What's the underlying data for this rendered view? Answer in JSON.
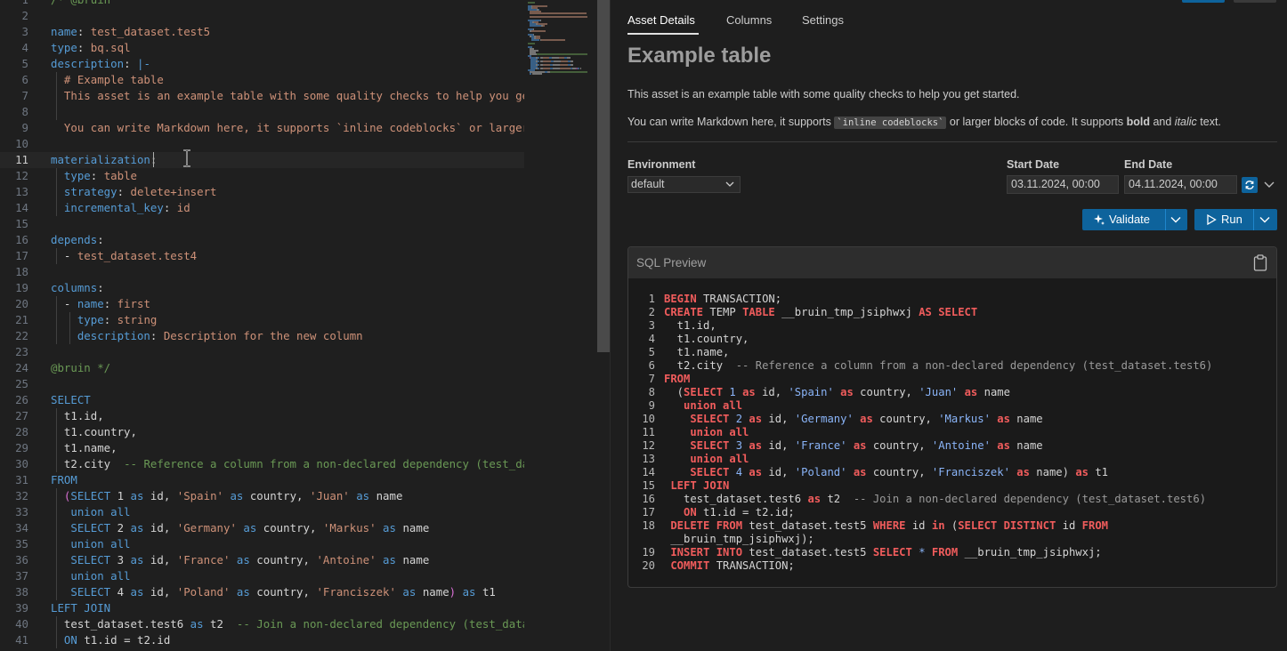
{
  "editor": {
    "line_numbers": [
      "1",
      "2",
      "3",
      "4",
      "5",
      "6",
      "7",
      "8",
      "9",
      "10",
      "11",
      "12",
      "13",
      "14",
      "15",
      "16",
      "17",
      "18",
      "19",
      "20",
      "21",
      "22",
      "23",
      "24",
      "25",
      "26",
      "27",
      "28",
      "29",
      "30",
      "31",
      "32",
      "33",
      "34",
      "35",
      "36",
      "37",
      "38",
      "39",
      "40",
      "41"
    ],
    "lines": [
      [
        [
          "c",
          "/* @bruin"
        ]
      ],
      [],
      [
        [
          "k",
          "name"
        ],
        [
          "t",
          ": "
        ],
        [
          "v",
          "test_dataset.test5"
        ]
      ],
      [
        [
          "k",
          "type"
        ],
        [
          "t",
          ": "
        ],
        [
          "v",
          "bq.sql"
        ]
      ],
      [
        [
          "k",
          "description"
        ],
        [
          "t",
          ": "
        ],
        [
          "k",
          "|-"
        ]
      ],
      [
        [
          "v",
          "  # Example table"
        ]
      ],
      [
        [
          "v",
          "  This asset is an example table with some quality checks to help you get"
        ]
      ],
      [],
      [
        [
          "v",
          "  You can write Markdown here, it supports `inline codeblocks` or larger b"
        ]
      ],
      [],
      [
        [
          "k",
          "materialization"
        ],
        [
          "t",
          ":"
        ]
      ],
      [
        [
          "k",
          "  type"
        ],
        [
          "t",
          ": "
        ],
        [
          "v",
          "table"
        ]
      ],
      [
        [
          "k",
          "  strategy"
        ],
        [
          "t",
          ": "
        ],
        [
          "v",
          "delete+insert"
        ]
      ],
      [
        [
          "k",
          "  incremental_key"
        ],
        [
          "t",
          ": "
        ],
        [
          "v",
          "id"
        ]
      ],
      [],
      [
        [
          "k",
          "depends"
        ],
        [
          "t",
          ":"
        ]
      ],
      [
        [
          "t",
          "  - "
        ],
        [
          "v",
          "test_dataset.test4"
        ]
      ],
      [],
      [
        [
          "k",
          "columns"
        ],
        [
          "t",
          ":"
        ]
      ],
      [
        [
          "t",
          "  - "
        ],
        [
          "k",
          "name"
        ],
        [
          "t",
          ": "
        ],
        [
          "v",
          "first"
        ]
      ],
      [
        [
          "k",
          "    type"
        ],
        [
          "t",
          ": "
        ],
        [
          "v",
          "string"
        ]
      ],
      [
        [
          "k",
          "    description"
        ],
        [
          "t",
          ": "
        ],
        [
          "v",
          "Description for the new column"
        ]
      ],
      [],
      [
        [
          "g",
          "@bruin */"
        ]
      ],
      [],
      [
        [
          "k",
          "SELECT"
        ]
      ],
      [
        [
          "t",
          "  t1.id,"
        ]
      ],
      [
        [
          "t",
          "  t1.country,"
        ]
      ],
      [
        [
          "t",
          "  t1.name,"
        ]
      ],
      [
        [
          "t",
          "  t2.city  "
        ],
        [
          "c",
          "-- Reference a column from a non-declared dependency (test_datas"
        ]
      ],
      [
        [
          "k",
          "FROM"
        ]
      ],
      [
        [
          "b",
          "  ("
        ],
        [
          "k",
          "SELECT "
        ],
        [
          "t",
          "1 "
        ],
        [
          "k",
          "as "
        ],
        [
          "t",
          "id, "
        ],
        [
          "s",
          "'Spain' "
        ],
        [
          "k",
          "as "
        ],
        [
          "t",
          "country, "
        ],
        [
          "s",
          "'Juan' "
        ],
        [
          "k",
          "as "
        ],
        [
          "t",
          "name"
        ]
      ],
      [
        [
          "k",
          "   union all"
        ]
      ],
      [
        [
          "k",
          "   SELECT "
        ],
        [
          "t",
          "2 "
        ],
        [
          "k",
          "as "
        ],
        [
          "t",
          "id, "
        ],
        [
          "s",
          "'Germany' "
        ],
        [
          "k",
          "as "
        ],
        [
          "t",
          "country, "
        ],
        [
          "s",
          "'Markus' "
        ],
        [
          "k",
          "as "
        ],
        [
          "t",
          "name"
        ]
      ],
      [
        [
          "k",
          "   union all"
        ]
      ],
      [
        [
          "k",
          "   SELECT "
        ],
        [
          "t",
          "3 "
        ],
        [
          "k",
          "as "
        ],
        [
          "t",
          "id, "
        ],
        [
          "s",
          "'France' "
        ],
        [
          "k",
          "as "
        ],
        [
          "t",
          "country, "
        ],
        [
          "s",
          "'Antoine' "
        ],
        [
          "k",
          "as "
        ],
        [
          "t",
          "name"
        ]
      ],
      [
        [
          "k",
          "   union all"
        ]
      ],
      [
        [
          "k",
          "   SELECT "
        ],
        [
          "t",
          "4 "
        ],
        [
          "k",
          "as "
        ],
        [
          "t",
          "id, "
        ],
        [
          "s",
          "'Poland' "
        ],
        [
          "k",
          "as "
        ],
        [
          "t",
          "country, "
        ],
        [
          "s",
          "'Franciszek' "
        ],
        [
          "k",
          "as "
        ],
        [
          "t",
          "name"
        ],
        [
          "b",
          ") "
        ],
        [
          "k",
          "as "
        ],
        [
          "t",
          "t1"
        ]
      ],
      [
        [
          "k",
          "LEFT JOIN"
        ]
      ],
      [
        [
          "t",
          "  test_dataset.test6 "
        ],
        [
          "k",
          "as "
        ],
        [
          "t",
          "t2  "
        ],
        [
          "c",
          "-- Join a non-declared dependency (test_datase"
        ]
      ],
      [
        [
          "k",
          "  ON "
        ],
        [
          "t",
          "t1.id = t2.id"
        ]
      ]
    ]
  },
  "panel": {
    "tabs": [
      "Asset Details",
      "Columns",
      "Settings"
    ],
    "title": "Example table",
    "description_1": "This asset is an example table with some quality checks to help you get started.",
    "description_2_pre": "You can write Markdown here, it supports ",
    "description_2_code": "`inline codeblocks`",
    "description_2_mid": " or larger blocks of code. It supports ",
    "description_2_bold": "bold",
    "description_2_and": " and ",
    "description_2_italic": "italic",
    "description_2_end": " text.",
    "environment_label": "Environment",
    "environment_value": "default",
    "start_date_label": "Start Date",
    "start_date_value": "03.11.2024, 00:00",
    "end_date_label": "End Date",
    "end_date_value": "04.11.2024, 00:00",
    "validate_label": "Validate",
    "run_label": "Run",
    "sql_preview_title": "SQL Preview",
    "sql_lines": [
      {
        "n": "1",
        "parts": [
          [
            "kw",
            "BEGIN "
          ],
          [
            "t",
            "TRANSACTION;"
          ]
        ]
      },
      {
        "n": "2",
        "parts": [
          [
            "kw",
            "CREATE "
          ],
          [
            "t",
            "TEMP "
          ],
          [
            "kw",
            "TABLE "
          ],
          [
            "t",
            "__bruin_tmp_jsiphwxj "
          ],
          [
            "kw",
            "AS SELECT"
          ]
        ]
      },
      {
        "n": "3",
        "parts": [
          [
            "t",
            "  t1.id,"
          ]
        ]
      },
      {
        "n": "4",
        "parts": [
          [
            "t",
            "  t1.country,"
          ]
        ]
      },
      {
        "n": "5",
        "parts": [
          [
            "t",
            "  t1.name,"
          ]
        ]
      },
      {
        "n": "6",
        "parts": [
          [
            "t",
            "  t2.city  "
          ],
          [
            "cm",
            "-- Reference a column from a non-declared dependency (test_dataset.test6)"
          ]
        ]
      },
      {
        "n": "7",
        "parts": [
          [
            "kw",
            "FROM"
          ]
        ]
      },
      {
        "n": "8",
        "parts": [
          [
            "t",
            "  ("
          ],
          [
            "kw",
            "SELECT "
          ],
          [
            "st",
            "1 "
          ],
          [
            "kw",
            "as "
          ],
          [
            "t",
            "id, "
          ],
          [
            "st",
            "'Spain' "
          ],
          [
            "kw",
            "as "
          ],
          [
            "t",
            "country, "
          ],
          [
            "st",
            "'Juan' "
          ],
          [
            "kw",
            "as "
          ],
          [
            "t",
            "name"
          ]
        ]
      },
      {
        "n": "9",
        "parts": [
          [
            "kw",
            "   union all"
          ]
        ]
      },
      {
        "n": "10",
        "parts": [
          [
            "kw",
            "    SELECT "
          ],
          [
            "st",
            "2 "
          ],
          [
            "kw",
            "as "
          ],
          [
            "t",
            "id, "
          ],
          [
            "st",
            "'Germany' "
          ],
          [
            "kw",
            "as "
          ],
          [
            "t",
            "country, "
          ],
          [
            "st",
            "'Markus' "
          ],
          [
            "kw",
            "as "
          ],
          [
            "t",
            "name"
          ]
        ]
      },
      {
        "n": "11",
        "parts": [
          [
            "kw",
            "    union all"
          ]
        ]
      },
      {
        "n": "12",
        "parts": [
          [
            "kw",
            "    SELECT "
          ],
          [
            "st",
            "3 "
          ],
          [
            "kw",
            "as "
          ],
          [
            "t",
            "id, "
          ],
          [
            "st",
            "'France' "
          ],
          [
            "kw",
            "as "
          ],
          [
            "t",
            "country, "
          ],
          [
            "st",
            "'Antoine' "
          ],
          [
            "kw",
            "as "
          ],
          [
            "t",
            "name"
          ]
        ]
      },
      {
        "n": "13",
        "parts": [
          [
            "kw",
            "    union all"
          ]
        ]
      },
      {
        "n": "14",
        "parts": [
          [
            "kw",
            "    SELECT "
          ],
          [
            "st",
            "4 "
          ],
          [
            "kw",
            "as "
          ],
          [
            "t",
            "id, "
          ],
          [
            "st",
            "'Poland' "
          ],
          [
            "kw",
            "as "
          ],
          [
            "t",
            "country, "
          ],
          [
            "st",
            "'Franciszek' "
          ],
          [
            "kw",
            "as "
          ],
          [
            "t",
            "name) "
          ],
          [
            "kw",
            "as "
          ],
          [
            "t",
            "t1"
          ]
        ]
      },
      {
        "n": "15",
        "parts": [
          [
            "kw",
            " LEFT JOIN"
          ]
        ]
      },
      {
        "n": "16",
        "parts": [
          [
            "t",
            "   test_dataset.test6 "
          ],
          [
            "kw",
            "as "
          ],
          [
            "t",
            "t2  "
          ],
          [
            "cm",
            "-- Join a non-declared dependency (test_dataset.test6)"
          ]
        ]
      },
      {
        "n": "17",
        "parts": [
          [
            "kw",
            "   ON "
          ],
          [
            "t",
            "t1.id = t2.id;"
          ]
        ]
      },
      {
        "n": "18",
        "parts": [
          [
            "kw",
            " DELETE FROM "
          ],
          [
            "t",
            "test_dataset.test5 "
          ],
          [
            "kw",
            "WHERE "
          ],
          [
            "t",
            "id "
          ],
          [
            "kw",
            "in "
          ],
          [
            "t",
            "("
          ],
          [
            "kw",
            "SELECT DISTINCT "
          ],
          [
            "t",
            "id "
          ],
          [
            "kw",
            "FROM"
          ]
        ]
      },
      {
        "n": "",
        "parts": [
          [
            "t",
            " __bruin_tmp_jsiphwxj);"
          ]
        ]
      },
      {
        "n": "19",
        "parts": [
          [
            "kw",
            " INSERT INTO "
          ],
          [
            "t",
            "test_dataset.test5 "
          ],
          [
            "kw",
            "SELECT "
          ],
          [
            "st",
            "* "
          ],
          [
            "kw",
            "FROM "
          ],
          [
            "t",
            "__bruin_tmp_jsiphwxj;"
          ]
        ]
      },
      {
        "n": "20",
        "parts": [
          [
            "kw",
            " COMMIT "
          ],
          [
            "t",
            "TRANSACTION;"
          ]
        ]
      }
    ]
  },
  "icons": {
    "validate": "sparkle-icon",
    "run": "play-icon",
    "refresh": "refresh-icon",
    "copy": "clipboard-icon"
  },
  "colors": {
    "accent": "#0e639c",
    "keyword_sql": "#f05c5c",
    "string_sql": "#8ab4f8"
  }
}
